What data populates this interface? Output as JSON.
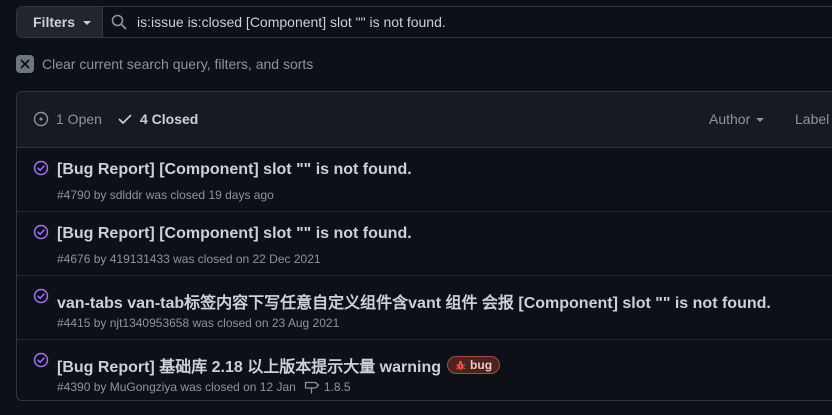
{
  "search": {
    "filters_label": "Filters",
    "query": "is:issue is:closed [Component] slot \"\" is not found."
  },
  "clear": {
    "label": "Clear current search query, filters, and sorts"
  },
  "header": {
    "open_label": "1 Open",
    "closed_label": "4 Closed",
    "author_label": "Author",
    "label_label": "Label"
  },
  "issues": [
    {
      "title": "[Bug Report] [Component] slot \"\" is not found.",
      "number": "#4790",
      "meta": "by sdlddr was closed 19 days ago"
    },
    {
      "title": "[Bug Report] [Component] slot \"\" is not found.",
      "number": "#4676",
      "meta": "by 419131433 was closed on 22 Dec 2021"
    },
    {
      "title": "van-tabs van-tab标签内容下写任意自定义组件含vant 组件 会报 [Component] slot \"\" is not found.",
      "number": "#4415",
      "meta": "by njt1340953658 was closed on 23 Aug 2021"
    },
    {
      "title": "[Bug Report] 基础库 2.18 以上版本提示大量 warning",
      "number": "#4390",
      "meta": "by MuGongziya was closed on 12 Jan",
      "label": "bug",
      "milestone": "1.8.5"
    }
  ],
  "colors": {
    "closed_purple": "#a371f7",
    "bug_red": "#f85149",
    "background": "#0d1117"
  }
}
